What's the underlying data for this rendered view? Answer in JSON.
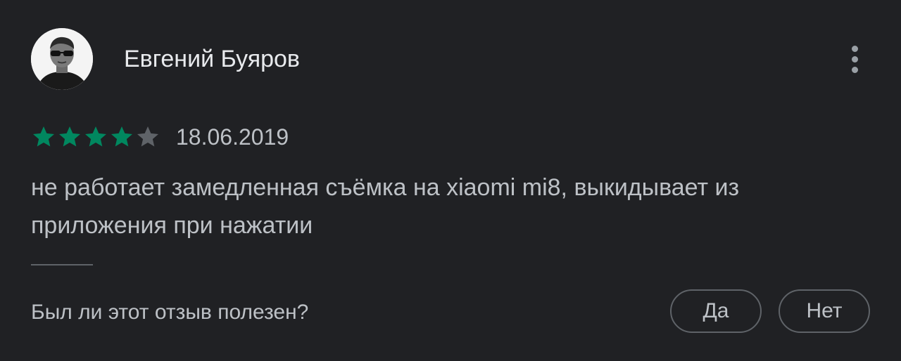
{
  "review": {
    "author": "Евгений Буяров",
    "rating": 4,
    "max_rating": 5,
    "date": "18.06.2019",
    "text": "не работает замедленная съёмка на xiaomi mi8, выкидывает из приложения при нажатии"
  },
  "feedback": {
    "question": "Был ли этот отзыв полезен?",
    "yes_label": "Да",
    "no_label": "Нет"
  },
  "icons": {
    "avatar": "user-avatar-photo",
    "more": "more-vert-icon",
    "star": "star-icon"
  },
  "colors": {
    "background": "#202124",
    "star_filled": "#01875f",
    "star_empty": "#5f6368",
    "text_primary": "#e8eaed",
    "text_secondary": "#bdc1c6"
  }
}
